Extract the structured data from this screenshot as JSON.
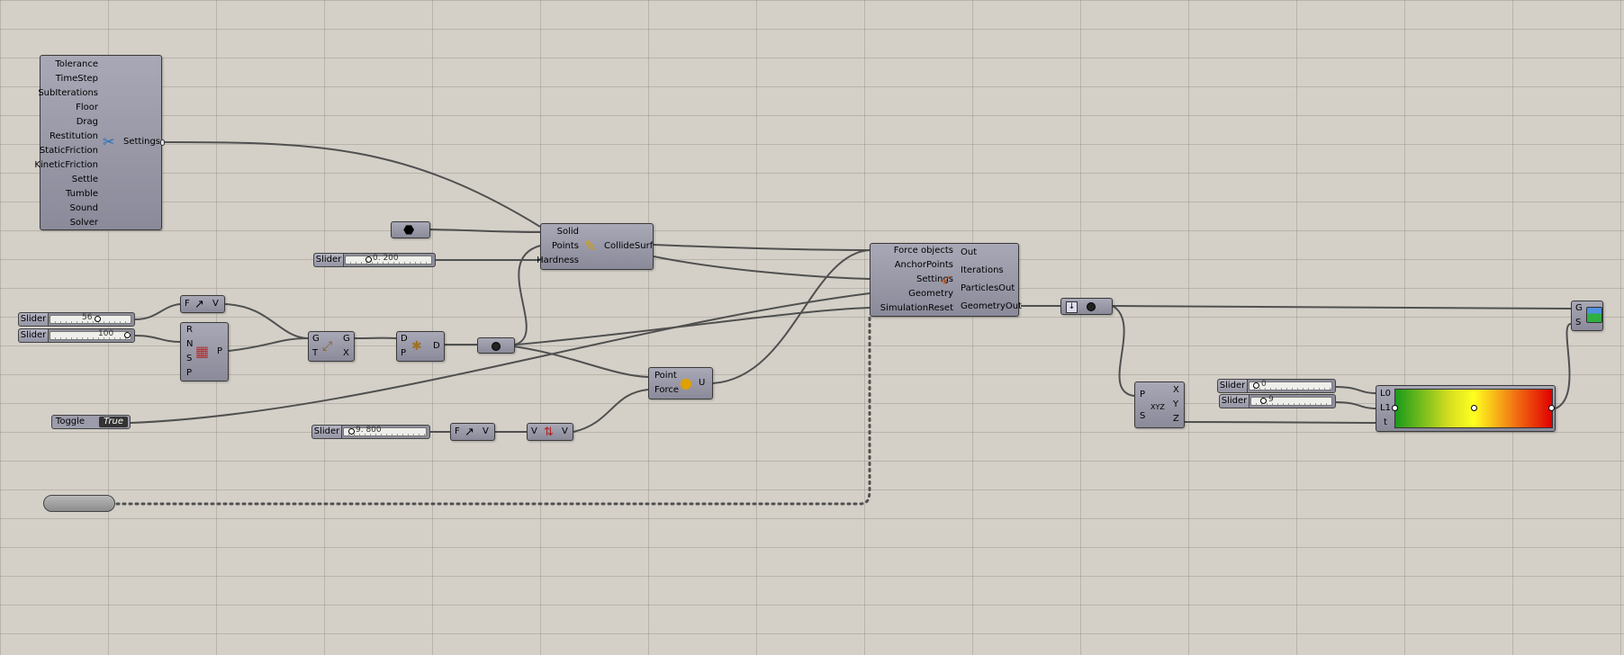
{
  "canvas": {
    "background": "#d4d0c8",
    "wire_color": "#505050"
  },
  "settings_component": {
    "inputs": [
      "Tolerance",
      "TimeStep",
      "SubIterations",
      "Floor",
      "Drag",
      "Restitution",
      "StaticFriction",
      "KineticFriction",
      "Settle",
      "Tumble",
      "Sound",
      "Solver"
    ],
    "output": "Settings",
    "icon": "wrench-screwdriver-icon"
  },
  "collide_surf": {
    "inputs": [
      "Solid",
      "Points",
      "Hardness"
    ],
    "output": "CollideSurf",
    "icon": "collide-icon"
  },
  "simulation": {
    "inputs": [
      "Force objects",
      "AnchorPoints",
      "Settings",
      "Geometry",
      "SimulationReset"
    ],
    "outputs": [
      "Out",
      "Iterations",
      "ParticlesOut",
      "GeometryOut"
    ],
    "icon": "kangaroo-icon"
  },
  "sliders": {
    "hardness": {
      "tag": "Slider",
      "value": "0. 200"
    },
    "count_a": {
      "tag": "Slider",
      "value": "56"
    },
    "count_b": {
      "tag": "Slider",
      "value": "100"
    },
    "gravity": {
      "tag": "Slider",
      "value": "9. 800"
    },
    "l0": {
      "tag": "Slider",
      "value": "0"
    },
    "l1": {
      "tag": "Slider",
      "value": "9"
    }
  },
  "toggle": {
    "tag": "Toggle",
    "state": "True"
  },
  "unit_z_1": {
    "inputs": [
      "F"
    ],
    "outputs": [
      "V"
    ]
  },
  "populate": {
    "inputs": [
      "R",
      "N",
      "S",
      "P"
    ],
    "outputs": [
      "P"
    ]
  },
  "orient": {
    "inputs": [
      "G",
      "T"
    ],
    "outputs": [
      "G",
      "X"
    ]
  },
  "dist": {
    "inputs": [
      "D",
      "P"
    ],
    "outputs": [
      "D"
    ]
  },
  "point_force": {
    "inputs": [
      "Point",
      "Force"
    ],
    "outputs": [
      "U"
    ]
  },
  "unit_z_2": {
    "inputs": [
      "F"
    ],
    "outputs": [
      "V"
    ]
  },
  "reverse": {
    "inputs": [
      "V"
    ],
    "outputs": [
      "V"
    ]
  },
  "deconstruct": {
    "inputs": [
      "P",
      "S"
    ],
    "outputs": [
      "X",
      "Y",
      "Z"
    ],
    "label": "XYZ"
  },
  "gradient": {
    "inputs": [
      "L0",
      "L1",
      "t"
    ],
    "colors": [
      "#1a9a1a",
      "#d8e020",
      "#ffff20",
      "#f06010",
      "#e00000"
    ]
  },
  "preview": {
    "inputs": [
      "G",
      "S"
    ]
  }
}
